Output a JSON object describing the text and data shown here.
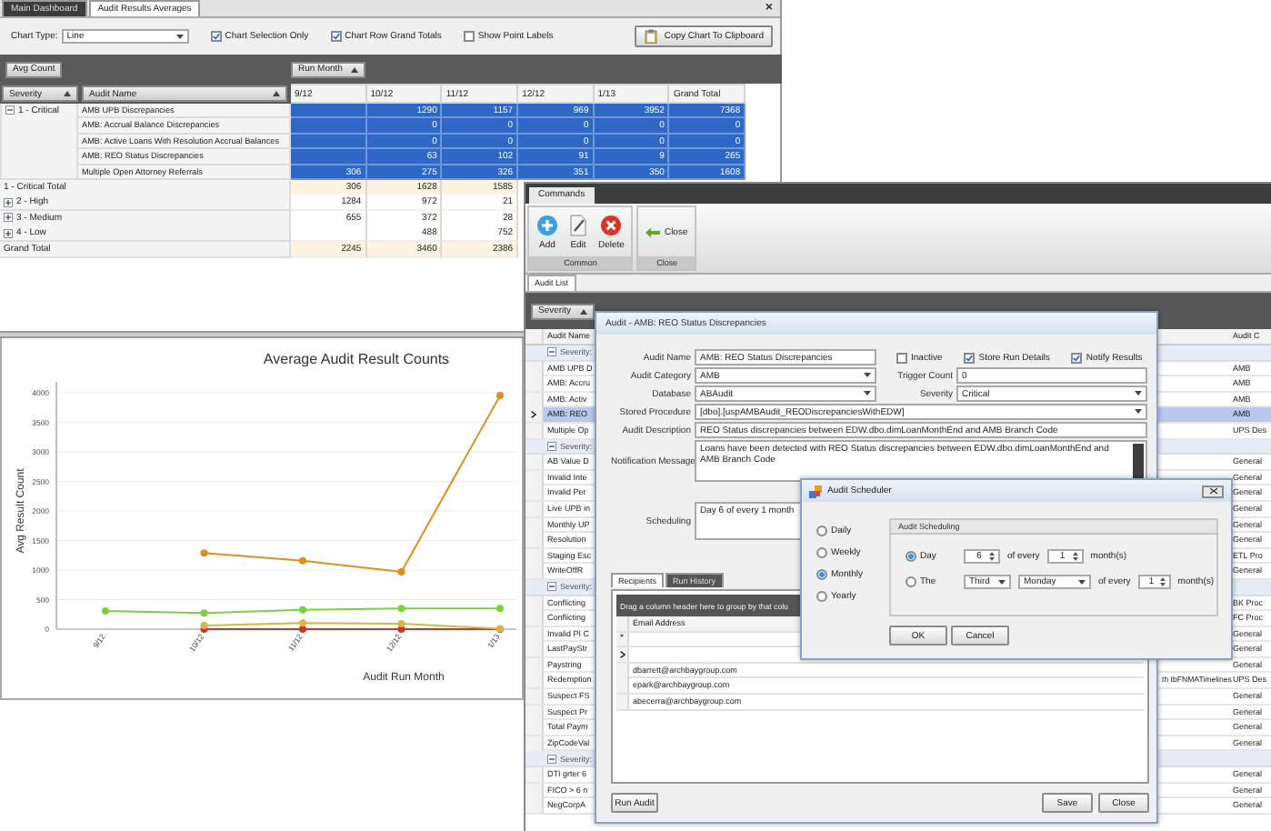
{
  "main_window": {
    "tabs": [
      {
        "label": "Main Dashboard",
        "selected": false
      },
      {
        "label": "Audit Results Averages",
        "selected": true
      }
    ],
    "close_glyph": "×",
    "toolbar": {
      "chart_type_label": "Chart Type:",
      "chart_type": "Line",
      "options": [
        {
          "label": "Chart Selection Only",
          "checked": true
        },
        {
          "label": "Chart Row Grand Totals",
          "checked": true
        },
        {
          "label": "Show Point Labels",
          "checked": false
        }
      ],
      "copy_button": "Copy Chart To Clipboard"
    },
    "pivot": {
      "data_field": "Avg Count",
      "column_field": "Run Month",
      "row_fields": [
        "Severity",
        "Audit Name"
      ],
      "columns": [
        "9/12",
        "10/12",
        "11/12",
        "12/12",
        "1/13",
        "Grand Total"
      ],
      "critical": {
        "label": "1 - Critical",
        "expanded": true,
        "rows": [
          {
            "name": "AMB UPB Discrepancies",
            "cells": [
              null,
              "1290",
              "1157",
              "969",
              "3952",
              "7368"
            ]
          },
          {
            "name": "AMB: Accrual Balance Discrepancies",
            "cells": [
              null,
              "0",
              "0",
              "0",
              "0",
              "0"
            ]
          },
          {
            "name": "AMB: Active Loans With Resolution Accrual Balances",
            "cells": [
              null,
              "0",
              "0",
              "0",
              "0",
              "0"
            ]
          },
          {
            "name": "AMB: REO Status Discrepancies",
            "cells": [
              null,
              "63",
              "102",
              "91",
              "9",
              "265"
            ]
          },
          {
            "name": "Multiple Open Attorney Referrals",
            "cells": [
              "306",
              "275",
              "326",
              "351",
              "350",
              "1608"
            ]
          }
        ]
      },
      "summary_rows": [
        {
          "label": "1 - Critical Total",
          "kind": "total",
          "cells": [
            "306",
            "1628",
            "1585"
          ]
        },
        {
          "label": "2 - High",
          "kind": "group",
          "expanded": false,
          "cells": [
            "1284",
            "972",
            "21"
          ]
        },
        {
          "label": "3 - Medium",
          "kind": "group",
          "expanded": false,
          "cells": [
            "655",
            "372",
            "28"
          ]
        },
        {
          "label": "4 - Low",
          "kind": "group",
          "expanded": false,
          "cells": [
            null,
            "488",
            "752"
          ]
        },
        {
          "label": "Grand Total",
          "kind": "total",
          "cells": [
            "2245",
            "3460",
            "2386"
          ]
        }
      ]
    },
    "chart": {
      "chart_data": {
        "type": "line",
        "title": "Average Audit Result Counts",
        "xlabel": "Audit Run Month",
        "ylabel": "Avg Result Count",
        "categories": [
          "9/12",
          "10/12",
          "11/12",
          "12/12",
          "1/13"
        ],
        "grid": true,
        "series": [
          {
            "color": "#d9901c",
            "marker": "circle",
            "values": [
              null,
              1290,
              1157,
              969,
              3952
            ]
          },
          {
            "color": "#7ccf3e",
            "marker": "circle",
            "values": [
              306,
              275,
              326,
              351,
              350
            ]
          },
          {
            "color": "#d8b44a",
            "marker": "circle",
            "values": [
              null,
              63,
              102,
              91,
              9
            ]
          },
          {
            "color": "#c0392b",
            "marker": "circle",
            "values": [
              null,
              0,
              0,
              0,
              0
            ]
          }
        ],
        "ylim": [
          0,
          4000
        ],
        "yticks": [
          0,
          500,
          1000,
          1500,
          2000,
          2500,
          3000,
          3500,
          4000
        ]
      }
    }
  },
  "commands_window": {
    "tab": "Commands",
    "ribbon_groups": [
      {
        "caption": "Common",
        "buttons": [
          {
            "label": "Add",
            "kind": "add"
          },
          {
            "label": "Edit",
            "kind": "edit"
          },
          {
            "label": "Delete",
            "kind": "delete"
          }
        ]
      },
      {
        "caption": "Close",
        "buttons": [
          {
            "label": "Close",
            "kind": "close"
          }
        ]
      }
    ],
    "list_tab": "Audit List",
    "group_field": "Severity",
    "columns": [
      "Audit Name",
      "Audit C"
    ],
    "groups": [
      {
        "label": "Severity:",
        "expanded": true,
        "rows": [
          {
            "name": "AMB UPB D",
            "category": "AMB",
            "selected": false
          },
          {
            "name": "AMB: Accru",
            "category": "AMB",
            "selected": false
          },
          {
            "name": "AMB: Activ",
            "category": "AMB",
            "selected": false
          },
          {
            "name": "AMB: REO",
            "category": "AMB",
            "selected": true
          },
          {
            "name": "Multiple Op",
            "category": "UPS Des",
            "selected": false
          }
        ]
      },
      {
        "label": "Severity:",
        "expanded": true,
        "rows": [
          {
            "name": "AB Value D",
            "category": "General",
            "selected": false
          },
          {
            "name": "Invalid Inte",
            "category": "General",
            "selected": false
          },
          {
            "name": "Invalid Per",
            "category": "General",
            "selected": false
          },
          {
            "name": "Live UPB in",
            "category": "General",
            "selected": false
          },
          {
            "name": "Monthly UP",
            "category": "General",
            "selected": false
          },
          {
            "name": "Resolution",
            "category": "General",
            "selected": false
          },
          {
            "name": "Staging Esc",
            "category": "ETL Pro",
            "selected": false
          },
          {
            "name": "WriteOffR",
            "category": "General",
            "selected": false
          }
        ]
      },
      {
        "label": "Severity:",
        "expanded": true,
        "rows": [
          {
            "name": "Conflicting",
            "category": "BK Proc",
            "selected": false
          },
          {
            "name": "Conflicting",
            "category": "FC Proc",
            "selected": false
          },
          {
            "name": "Invalid PI C",
            "category": "General",
            "selected": false
          },
          {
            "name": "LastPayStr",
            "category": "General",
            "selected": false
          },
          {
            "name": "Paystring",
            "category": "General",
            "selected": false
          },
          {
            "name": "Redemption",
            "description": "th tbFNMATimelines",
            "category": "UPS Des",
            "selected": false
          },
          {
            "name": "Suspect FS",
            "category": "General",
            "selected": false
          },
          {
            "name": "Suspect Pr",
            "category": "General",
            "selected": false
          },
          {
            "name": "Total Paym",
            "category": "General",
            "selected": false
          },
          {
            "name": "ZipCodeVal",
            "category": "General",
            "selected": false
          }
        ]
      },
      {
        "label": "Severity:",
        "expanded": true,
        "rows": [
          {
            "name": "DTI grter 6",
            "category": "General",
            "selected": false
          },
          {
            "name": "FICO > 6 n",
            "category": "General",
            "selected": false
          },
          {
            "name": "NegCorpA",
            "category": "General",
            "selected": false
          }
        ]
      }
    ]
  },
  "audit_dialog": {
    "title": "Audit - AMB: REO Status Discrepancies",
    "audit_name": {
      "label": "Audit Name",
      "value": "AMB: REO Status Discrepancies"
    },
    "flags": [
      {
        "label": "Inactive",
        "checked": false
      },
      {
        "label": "Store Run Details",
        "checked": true
      },
      {
        "label": "Notify Results",
        "checked": true
      }
    ],
    "audit_category": {
      "label": "Audit Category",
      "value": "AMB"
    },
    "trigger_count": {
      "label": "Trigger Count",
      "value": "0"
    },
    "database": {
      "label": "Database",
      "value": "ABAudit"
    },
    "severity": {
      "label": "Severity",
      "value": "Critical"
    },
    "stored_procedure": {
      "label": "Stored Procedure",
      "value": "[dbo].[uspAMBAudit_REODiscrepanciesWithEDW]"
    },
    "audit_description": {
      "label": "Audit Description",
      "value": "REO Status discrepancies between EDW.dbo.dimLoanMonthEnd and AMB Branch Code"
    },
    "notification_message": {
      "label": "Notification Message",
      "value": "Loans have been detected with REO Status discrepancies between EDW.dbo.dimLoanMonthEnd and AMB Branch Code"
    },
    "scheduling": {
      "label": "Scheduling",
      "value": "Day 6 of every 1 month"
    },
    "tabs": [
      {
        "label": "Recipients",
        "selected": true
      },
      {
        "label": "Run History",
        "selected": false
      }
    ],
    "group_hint": "Drag a column header here to group by that colu",
    "recipients_column": "Email Address",
    "new_row_glyph": "*",
    "recipients": [
      "dbarrett@archbaygroup.com",
      "epark@archbaygroup.com",
      "abecerra@archbaygroup.com"
    ],
    "run_button": "Run Audit",
    "save_button": "Save",
    "close_button": "Close"
  },
  "scheduler": {
    "title": "Audit Scheduler",
    "frequencies": [
      {
        "label": "Daily",
        "selected": false
      },
      {
        "label": "Weekly",
        "selected": false
      },
      {
        "label": "Monthly",
        "selected": true
      },
      {
        "label": "Yearly",
        "selected": false
      }
    ],
    "group_title": "Audit Scheduling",
    "day_option": {
      "label": "Day",
      "selected": true,
      "day": "6",
      "of_every": "of every",
      "months": "1",
      "unit": "month(s)"
    },
    "the_option": {
      "label": "The",
      "selected": false,
      "ordinal": "Third",
      "weekday": "Monday",
      "of_every": "of every",
      "months": "1",
      "unit": "month(s)"
    },
    "ok_button": "OK",
    "cancel_button": "Cancel"
  }
}
